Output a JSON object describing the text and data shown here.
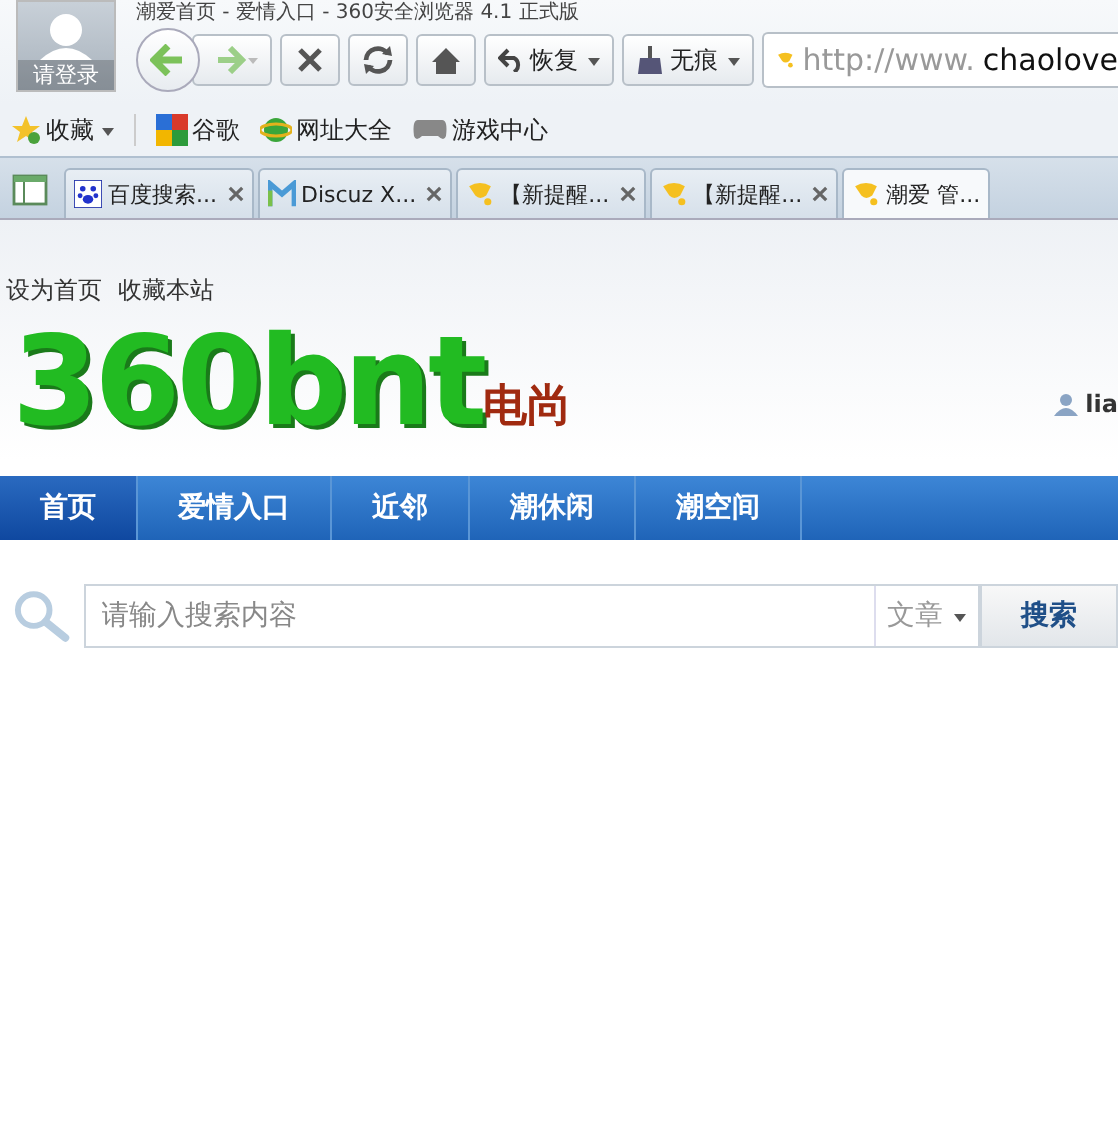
{
  "window": {
    "title": "潮爱首页 - 爱情入口 - 360安全浏览器 4.1 正式版",
    "login_label": "请登录"
  },
  "toolbar": {
    "restore_button": "恢复",
    "incognito_button": "无痕",
    "address": {
      "prefix": "http://www.",
      "domain": "chaolove"
    }
  },
  "bookmarks": [
    {
      "kind": "favorites",
      "label": "收藏"
    },
    {
      "kind": "google",
      "label": "谷歌"
    },
    {
      "kind": "ie",
      "label": "网址大全"
    },
    {
      "kind": "game",
      "label": "游戏中心"
    }
  ],
  "tabs": [
    {
      "kind": "paw",
      "label": "百度搜索...",
      "selected": false
    },
    {
      "kind": "m",
      "label": "Discuz X...",
      "selected": false
    },
    {
      "kind": "bell",
      "label": "【新提醒...",
      "selected": false
    },
    {
      "kind": "bell",
      "label": "【新提醒...",
      "selected": false
    },
    {
      "kind": "bell",
      "label": "潮爱 管...",
      "selected": true
    }
  ],
  "page": {
    "top_links": [
      "设为首页",
      "收藏本站"
    ],
    "logo": {
      "main": "360bnt",
      "sub": "电尚"
    },
    "user": "lia",
    "nav": [
      {
        "label": "首页",
        "selected": true
      },
      {
        "label": "爱情入口",
        "selected": false
      },
      {
        "label": "近邻",
        "selected": false
      },
      {
        "label": "潮休闲",
        "selected": false
      },
      {
        "label": "潮空间",
        "selected": false
      }
    ],
    "search": {
      "placeholder": "请输入搜索内容",
      "scope": "文章",
      "button": "搜索"
    }
  }
}
